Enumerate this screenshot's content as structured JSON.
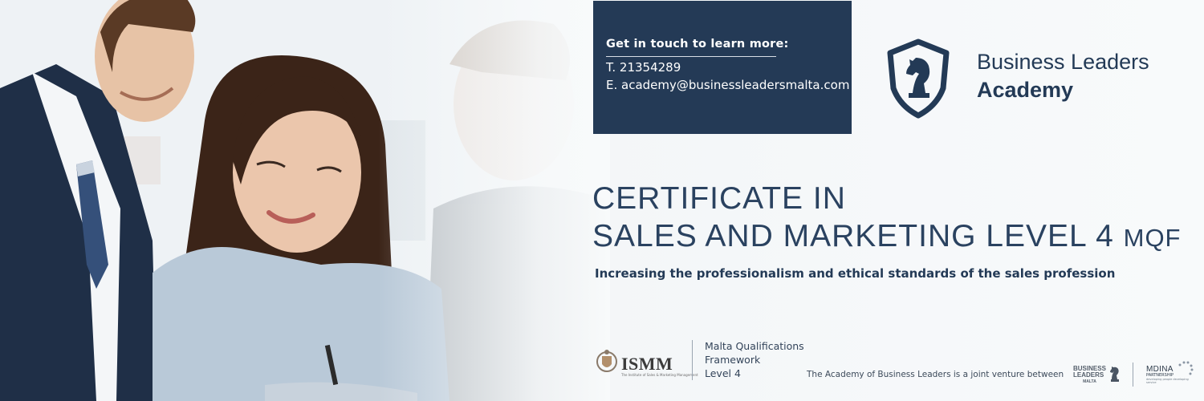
{
  "contact": {
    "heading": "Get in touch to learn more:",
    "phone": "T. 21354289",
    "email": "E. academy@businessleadersmalta.com"
  },
  "logo": {
    "line1": "Business Leaders",
    "line2": "Academy"
  },
  "course": {
    "title_line1": "CERTIFICATE IN",
    "title_line2_main": "SALES AND MARKETING LEVEL 4 ",
    "title_line2_small": "MQF",
    "subtitle": "Increasing the professionalism and ethical standards of the sales profession"
  },
  "ismm": {
    "name": "ISMM",
    "tagline": "The Institute of Sales & Marketing Management"
  },
  "mqf": {
    "line1": "Malta Qualifications",
    "line2": "Framework",
    "line3": "Level 4"
  },
  "footer": {
    "joint_venture": "The Academy of Business Leaders is a joint venture between",
    "bl_line1": "BUSINESS",
    "bl_line2": "LEADERS",
    "bl_line3": "MALTA",
    "mdina_line1": "MDINA",
    "mdina_line2": "PARTNERSHIP",
    "mdina_line3": "developing people developing service"
  },
  "colors": {
    "navy": "#243a56",
    "background": "#f3f6f8",
    "text": "#233a56"
  },
  "icons": [
    "knight-shield-icon",
    "ismm-crest-icon",
    "mdina-dots-icon"
  ]
}
